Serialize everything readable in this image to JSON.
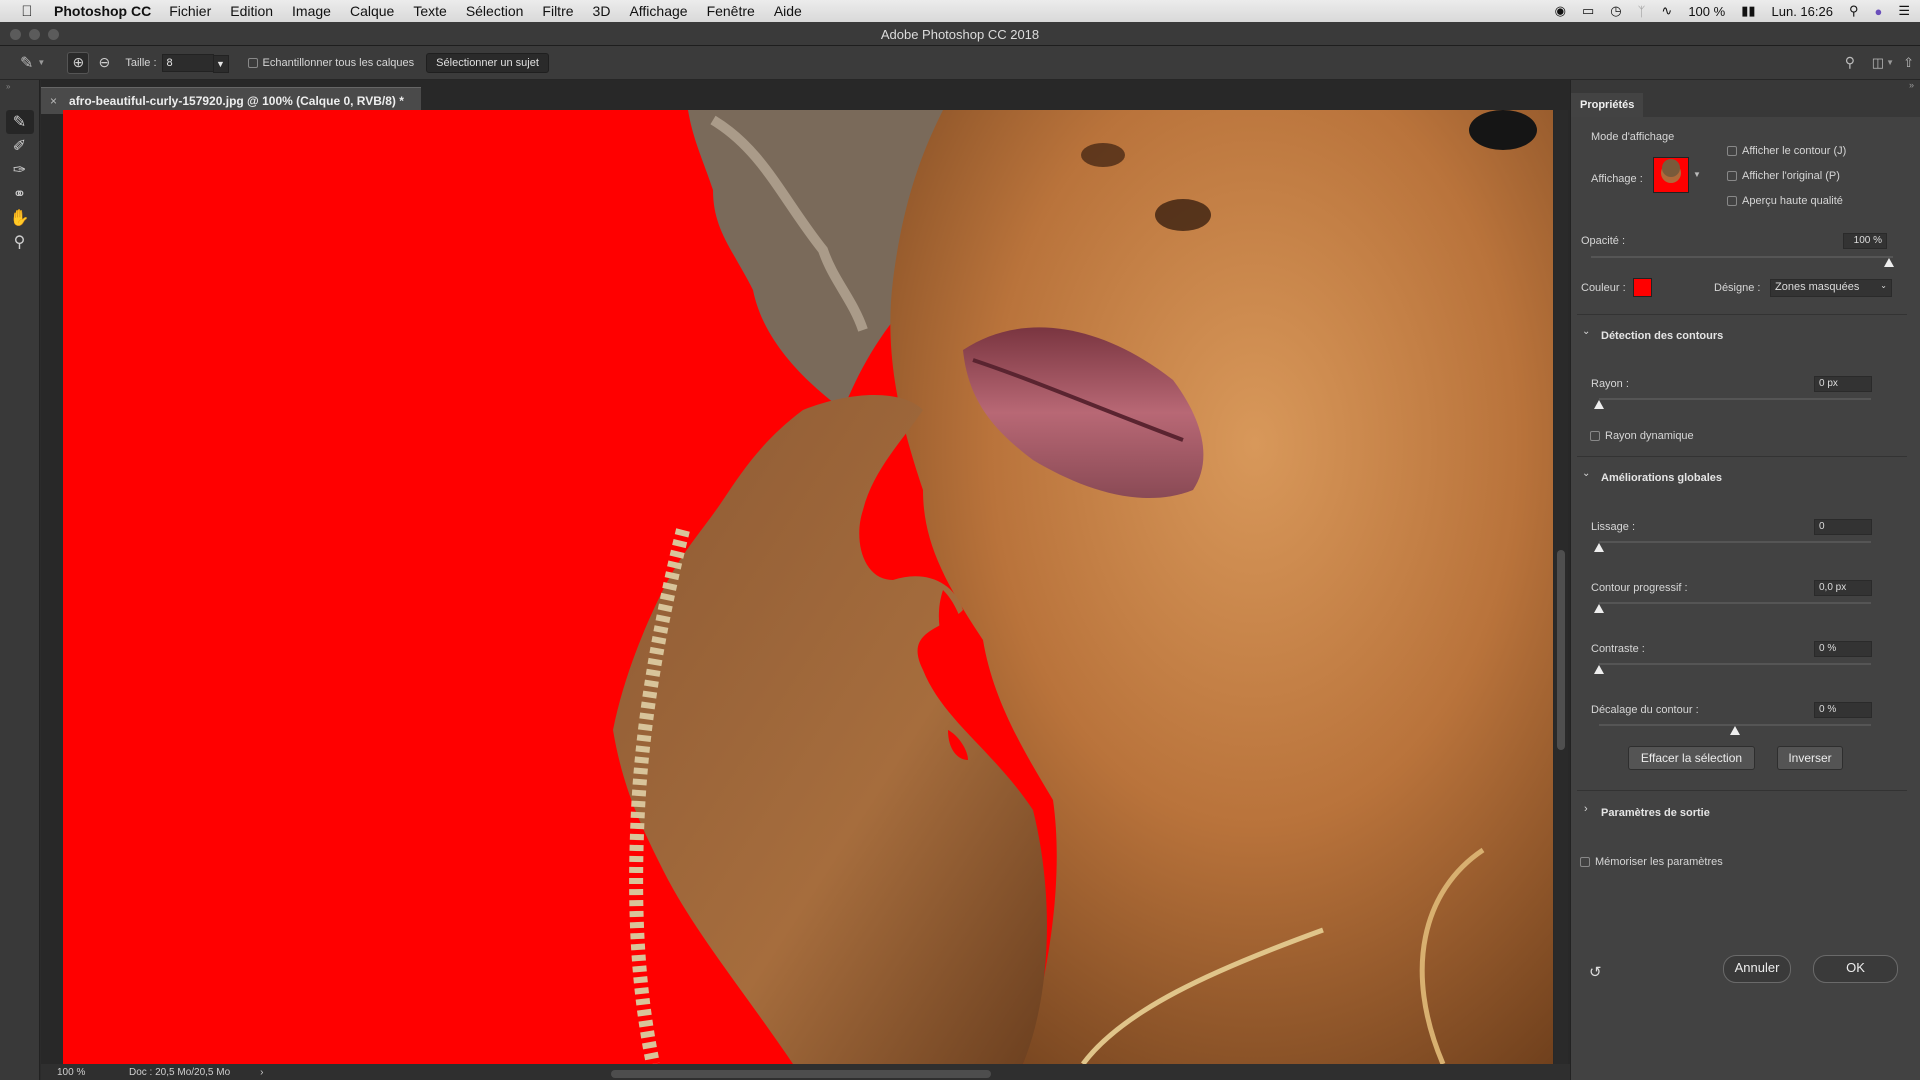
{
  "menubar": {
    "app_name": "Photoshop CC",
    "items": [
      "Fichier",
      "Edition",
      "Image",
      "Calque",
      "Texte",
      "Sélection",
      "Filtre",
      "3D",
      "Affichage",
      "Fenêtre",
      "Aide"
    ],
    "battery": "100 %",
    "clock": "Lun. 16:26"
  },
  "window": {
    "title": "Adobe Photoshop CC 2018"
  },
  "options": {
    "size_label": "Taille :",
    "size_value": "8",
    "sample_all_label": "Echantillonner tous les calques",
    "select_subject_label": "Sélectionner un sujet"
  },
  "document": {
    "tab_title": "afro-beautiful-curly-157920.jpg @ 100% (Calque 0, RVB/8) *",
    "zoom": "100 %",
    "doc_info": "Doc : 20,5 Mo/20,5 Mo"
  },
  "panel": {
    "tab": "Propriétés",
    "view_mode": {
      "heading": "Mode d'affichage",
      "display_label": "Affichage :",
      "show_edge": "Afficher le contour (J)",
      "show_original": "Afficher l'original (P)",
      "high_quality": "Aperçu haute qualité"
    },
    "opacity": {
      "label": "Opacité :",
      "value": "100 %",
      "fraction": 1.0
    },
    "color": {
      "label": "Couleur :",
      "swatch": "#ff0000",
      "designate_label": "Désigne :",
      "designate_value": "Zones masquées"
    },
    "edge_detection": {
      "heading": "Détection des contours",
      "radius_label": "Rayon :",
      "radius_value": "0 px",
      "smart_radius": "Rayon dynamique"
    },
    "global": {
      "heading": "Améliorations globales",
      "smooth_label": "Lissage :",
      "smooth_value": "0",
      "feather_label": "Contour progressif :",
      "feather_value": "0,0 px",
      "contrast_label": "Contraste :",
      "contrast_value": "0 %",
      "shift_label": "Décalage du contour :",
      "shift_value": "0 %",
      "clear_button": "Effacer la sélection",
      "invert_button": "Inverser"
    },
    "output": {
      "heading": "Paramètres de sortie",
      "remember": "Mémoriser les paramètres"
    },
    "footer": {
      "cancel": "Annuler",
      "ok": "OK"
    }
  }
}
